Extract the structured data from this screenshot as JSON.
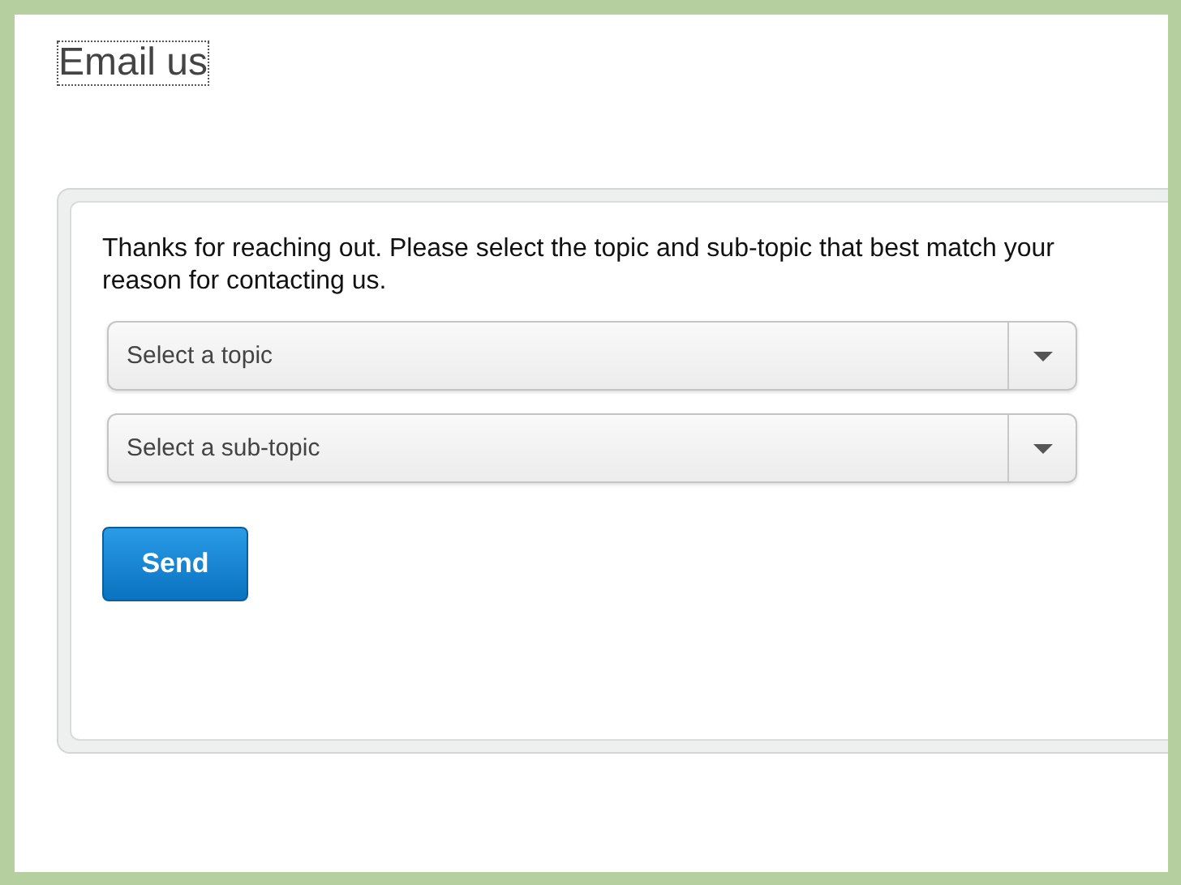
{
  "title": "Email us",
  "intro": "Thanks for reaching out. Please select the topic and sub-topic that best match your reason for contacting us.",
  "selects": [
    {
      "placeholder": "Select a topic"
    },
    {
      "placeholder": "Select a sub-topic"
    }
  ],
  "send_button": "Send"
}
